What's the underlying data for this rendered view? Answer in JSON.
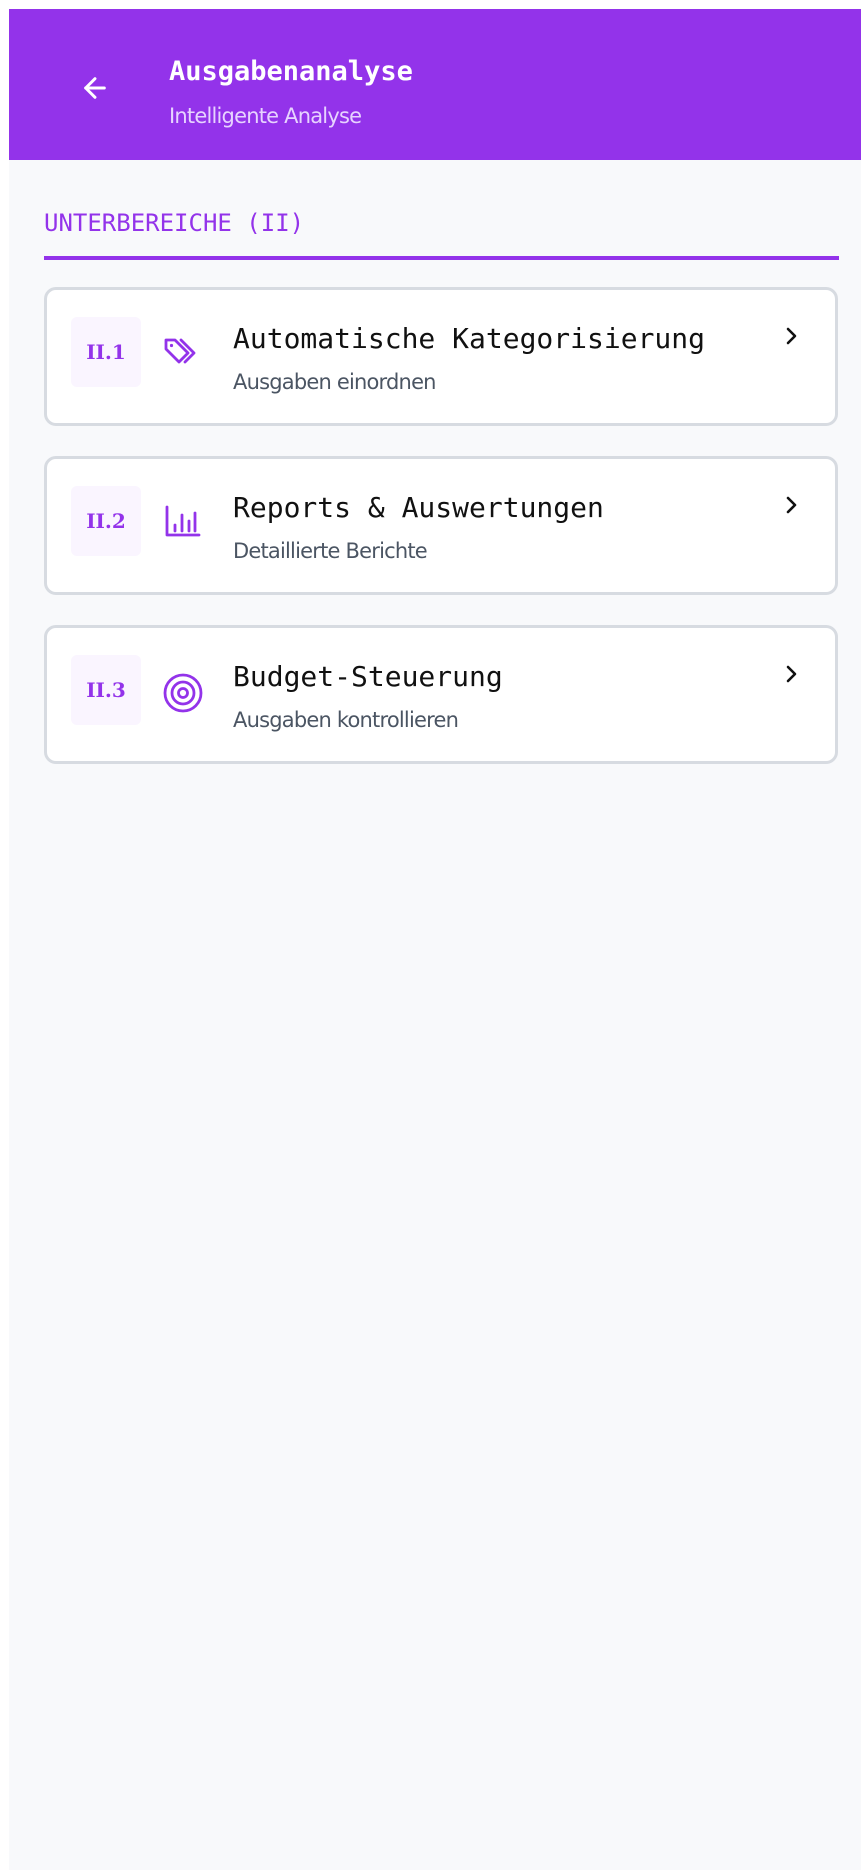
{
  "app_header": {
    "title": "Ausgabenanalyse",
    "subtitle": "Intelligente Analyse",
    "back_icon": "arrow-left-icon"
  },
  "section": {
    "heading": "UNTERBEREICHE (II)"
  },
  "subsections": [
    {
      "code": "II.1",
      "icon": "tags-icon",
      "title": "Automatische Kategorisierung",
      "description": "Ausgaben einordnen"
    },
    {
      "code": "II.2",
      "icon": "bar-chart-icon",
      "title": "Reports & Auswertungen",
      "description": "Detaillierte Berichte"
    },
    {
      "code": "II.3",
      "icon": "target-icon",
      "title": "Budget-Steuerung",
      "description": "Ausgaben kontrollieren"
    }
  ],
  "colors": {
    "header_background": "#9333ea",
    "accent": "#9333ea",
    "page_background": "#f8f9fb",
    "card_border": "#d7dbe1",
    "code_badge_background": "#faf5ff"
  }
}
